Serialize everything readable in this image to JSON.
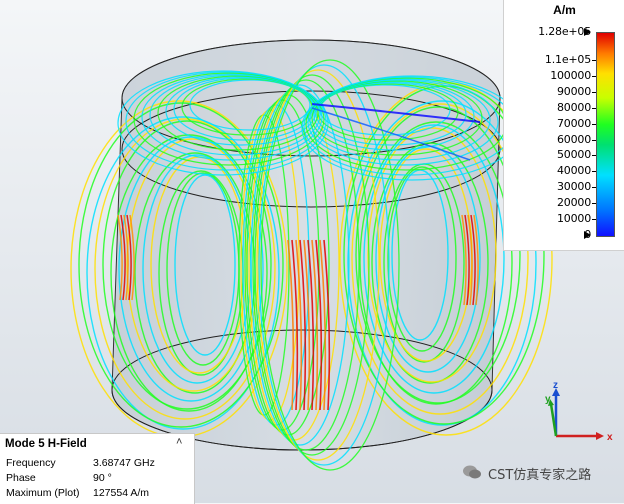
{
  "legend": {
    "unit": "A/m",
    "ticks": [
      {
        "label": "1.28e+05",
        "value": 127554,
        "arrow": true
      },
      {
        "label": "1.1e+05",
        "value": 110000
      },
      {
        "label": "100000",
        "value": 100000
      },
      {
        "label": "90000",
        "value": 90000
      },
      {
        "label": "80000",
        "value": 80000
      },
      {
        "label": "70000",
        "value": 70000
      },
      {
        "label": "60000",
        "value": 60000
      },
      {
        "label": "50000",
        "value": 50000
      },
      {
        "label": "40000",
        "value": 40000
      },
      {
        "label": "30000",
        "value": 30000
      },
      {
        "label": "20000",
        "value": 20000
      },
      {
        "label": "10000",
        "value": 10000
      },
      {
        "label": "0",
        "value": 0,
        "arrow": true
      }
    ],
    "max": 127554,
    "colors": [
      "#1010ff",
      "#00e0ff",
      "#20ff20",
      "#ffe000",
      "#e00000"
    ]
  },
  "info": {
    "title": "Mode 5 H-Field",
    "collapse_icon": "chevron-up-icon",
    "rows": [
      {
        "label": "Frequency",
        "value": "3.68747 GHz"
      },
      {
        "label": "Phase",
        "value": "90 °"
      },
      {
        "label": "Maximum (Plot)",
        "value": "127554 A/m"
      }
    ]
  },
  "axes": {
    "x": "x",
    "y": "y",
    "z": "z"
  },
  "watermark": {
    "text": "CST仿真专家之路",
    "icon": "wechat-icon"
  }
}
